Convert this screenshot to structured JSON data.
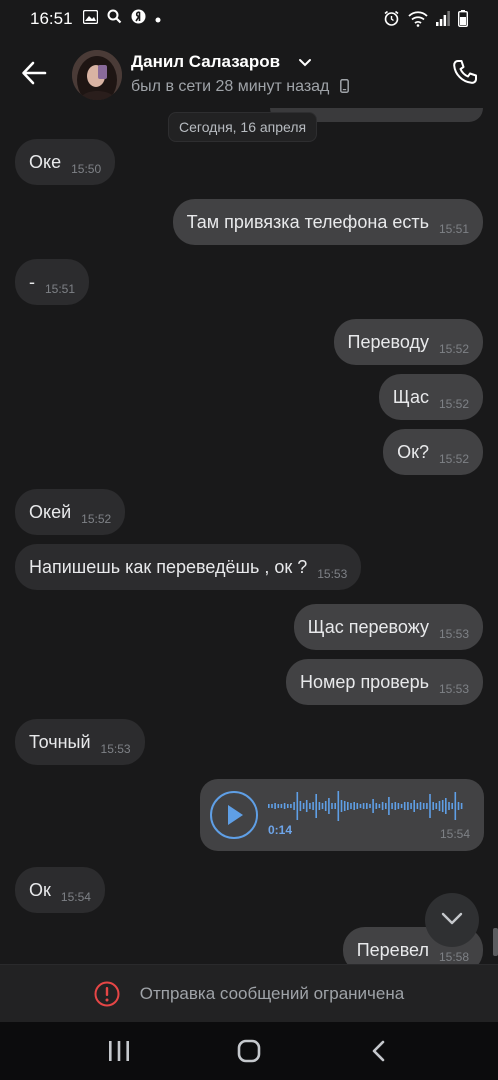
{
  "status_bar": {
    "time": "16:51",
    "left_icons": [
      "image-icon",
      "search-icon",
      "yandex-icon",
      "dot-icon"
    ],
    "right_icons": [
      "alarm-icon",
      "wifi-icon",
      "signal-icon",
      "battery-icon"
    ]
  },
  "header": {
    "name": "Данил Салазаров",
    "status": "был в сети 28 минут назад"
  },
  "date_separator": "Сегодня, 16 апреля",
  "messages": [
    {
      "dir": "in",
      "text": "Оке",
      "time": "15:50"
    },
    {
      "dir": "out",
      "text": "Там привязка телефона есть",
      "time": "15:51"
    },
    {
      "dir": "in",
      "text": "-",
      "time": "15:51"
    },
    {
      "dir": "out",
      "text": "Переводу",
      "time": "15:52"
    },
    {
      "dir": "out",
      "text": "Щас",
      "time": "15:52"
    },
    {
      "dir": "out",
      "text": "Ок?",
      "time": "15:52"
    },
    {
      "dir": "in",
      "text": "Окей",
      "time": "15:52"
    },
    {
      "dir": "in",
      "text": "Напишешь как переведёшь , ок ?",
      "time": "15:53"
    },
    {
      "dir": "out",
      "text": "Щас перевожу",
      "time": "15:53"
    },
    {
      "dir": "out",
      "text": "Номер проверь",
      "time": "15:53"
    },
    {
      "dir": "in",
      "text": "Точный",
      "time": "15:53"
    },
    {
      "dir": "in",
      "text": "Ок",
      "time": "15:54"
    },
    {
      "dir": "out",
      "text": "Перевел",
      "time": "15:58"
    }
  ],
  "voice_message": {
    "duration": "0:14",
    "time": "15:54"
  },
  "composer": {
    "restricted_text": "Отправка сообщений ограничена"
  },
  "colors": {
    "accent": "#5f9fe6",
    "bubble_in": "#2c2c2e",
    "bubble_out": "#424244",
    "background": "#19191a",
    "warning": "#e64646"
  }
}
